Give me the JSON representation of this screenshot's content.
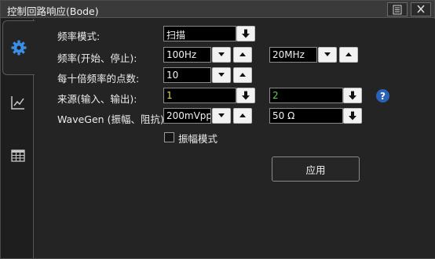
{
  "window": {
    "title": "控制回路响应(Bode)"
  },
  "sidebar": {
    "tabs": [
      {
        "icon": "gear-icon",
        "active": true
      },
      {
        "icon": "line-chart-icon",
        "active": false
      },
      {
        "icon": "table-icon",
        "active": false
      }
    ]
  },
  "form": {
    "mode": {
      "label": "频率模式:",
      "value": "扫描"
    },
    "frequency": {
      "label": "频率(开始、停止):",
      "start": "100Hz",
      "stop": "20MHz"
    },
    "points": {
      "label": "每十倍频率的点数:",
      "value": "10"
    },
    "source": {
      "label": "来源(输入、输出):",
      "input": "1",
      "output": "2",
      "input_color": "#e8d84a",
      "output_color": "#5fd04e"
    },
    "wavegen": {
      "label": "WaveGen (振幅、阻抗):",
      "amplitude": "200mVpp",
      "impedance": "50 Ω"
    },
    "amplitude_profile": {
      "label": "振幅模式",
      "checked": false
    },
    "help": "?",
    "apply": "应用"
  }
}
